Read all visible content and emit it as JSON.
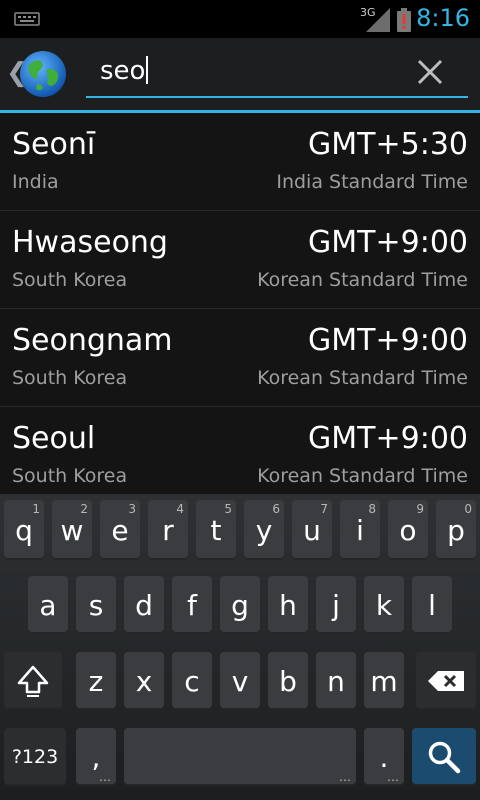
{
  "status": {
    "network": "3G",
    "time": "8:16"
  },
  "search": {
    "query": "seo"
  },
  "results": [
    {
      "city": "Seonī",
      "country": "India",
      "offset": "GMT+5:30",
      "timezone": "India Standard Time"
    },
    {
      "city": "Hwaseong",
      "country": "South Korea",
      "offset": "GMT+9:00",
      "timezone": "Korean Standard Time"
    },
    {
      "city": "Seongnam",
      "country": "South Korea",
      "offset": "GMT+9:00",
      "timezone": "Korean Standard Time"
    },
    {
      "city": "Seoul",
      "country": "South Korea",
      "offset": "GMT+9:00",
      "timezone": "Korean Standard Time"
    }
  ],
  "keyboard": {
    "row1": [
      {
        "label": "q",
        "hint": "1"
      },
      {
        "label": "w",
        "hint": "2"
      },
      {
        "label": "e",
        "hint": "3"
      },
      {
        "label": "r",
        "hint": "4"
      },
      {
        "label": "t",
        "hint": "5"
      },
      {
        "label": "y",
        "hint": "6"
      },
      {
        "label": "u",
        "hint": "7"
      },
      {
        "label": "i",
        "hint": "8"
      },
      {
        "label": "o",
        "hint": "9"
      },
      {
        "label": "p",
        "hint": "0"
      }
    ],
    "row2": [
      "a",
      "s",
      "d",
      "f",
      "g",
      "h",
      "j",
      "k",
      "l"
    ],
    "row3": [
      "z",
      "x",
      "c",
      "v",
      "b",
      "n",
      "m"
    ],
    "symbols_label": "?123",
    "comma_label": ",",
    "period_label": "."
  },
  "colors": {
    "accent": "#33b5e5",
    "background": "#141414",
    "secondary_text": "#9e9e9e"
  },
  "icons": {
    "back": "chevron-left-icon",
    "app": "globe-icon",
    "clear": "close-icon",
    "keyboard_status": "keyboard-icon",
    "signal": "signal-icon",
    "battery": "battery-alert-icon",
    "shift": "shift-icon",
    "backspace": "backspace-icon",
    "search": "search-icon"
  }
}
